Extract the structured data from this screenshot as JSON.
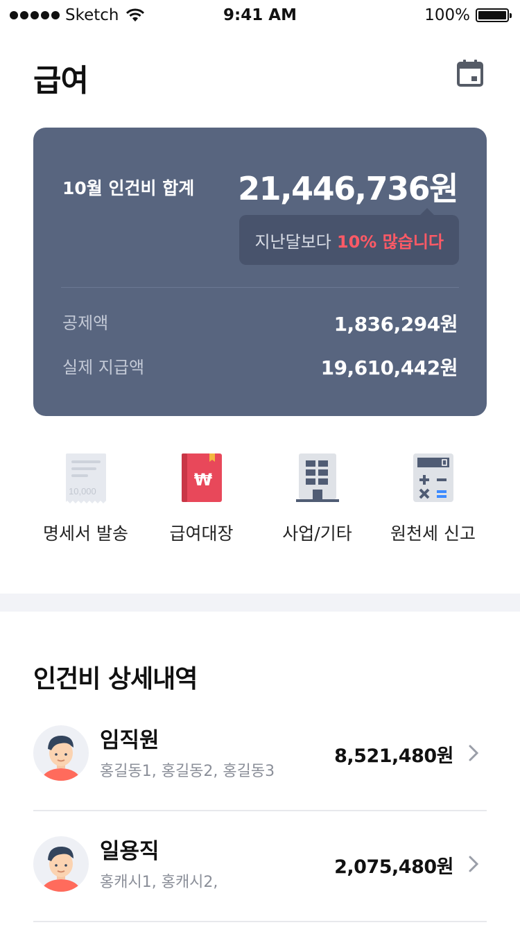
{
  "status_bar": {
    "carrier": "Sketch",
    "time": "9:41 AM",
    "battery": "100%"
  },
  "header": {
    "title": "급여",
    "calendar_icon": "calendar-icon"
  },
  "summary": {
    "label": "10월 인건비 합계",
    "total": "21,446,736원",
    "comparison_prefix": "지난달보다",
    "comparison_highlight": "10% 많습니다",
    "deduction_label": "공제액",
    "deduction_value": "1,836,294원",
    "actual_label": "실제 지급액",
    "actual_value": "19,610,442원"
  },
  "actions": [
    {
      "label": "명세서 발송",
      "icon": "receipt-icon"
    },
    {
      "label": "급여대장",
      "icon": "ledger-book-icon"
    },
    {
      "label": "사업/기타",
      "icon": "building-icon"
    },
    {
      "label": "원천세 신고",
      "icon": "calculator-icon"
    }
  ],
  "receipt_amount_text": "10,000",
  "section": {
    "title": "인건비 상세내역",
    "items": [
      {
        "name": "임직원",
        "members": "홍길동1, 홍길동2, 홍길동3",
        "amount": "8,521,480원"
      },
      {
        "name": "일용직",
        "members": "홍캐시1, 홍캐시2,",
        "amount": "2,075,480원"
      }
    ]
  },
  "colors": {
    "card_bg": "#58657f",
    "tooltip_bg": "#48536c",
    "highlight": "#ff5a66",
    "ledger_red": "#e8485a"
  }
}
